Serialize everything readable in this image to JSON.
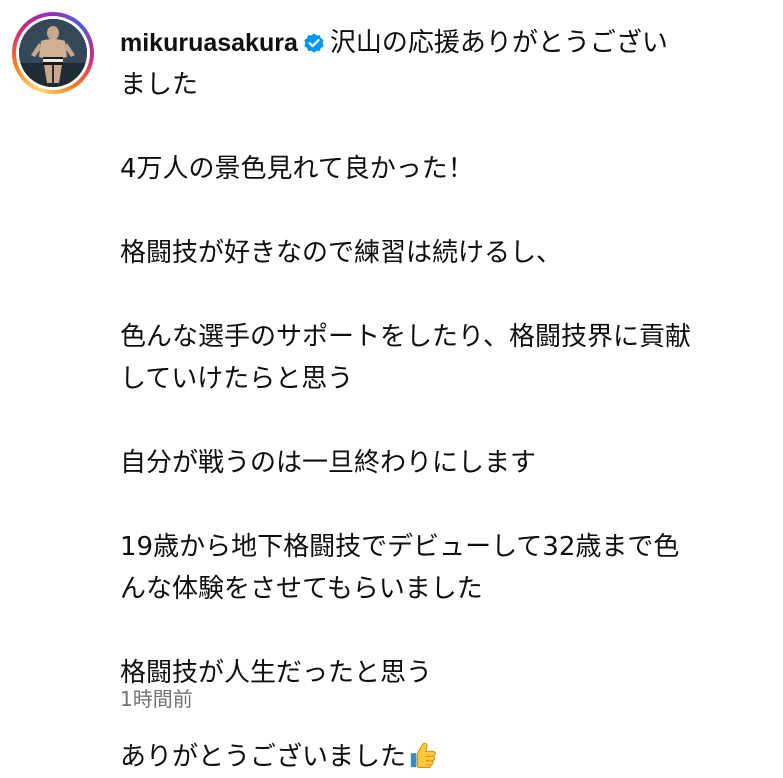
{
  "post": {
    "username": "mikuruasakura",
    "verified": true,
    "caption_lines": [
      "沢山の応援ありがとうござい",
      "ました",
      "",
      "4万人の景色見れて良かった！",
      "",
      "格闘技が好きなので練習は続けるし、",
      "",
      "色んな選手のサポートをしたり、格闘技界に貢献",
      "していけたらと思う",
      "",
      "自分が戦うのは一旦終わりにします",
      "",
      "19歳から地下格闘技でデビューして32歳まで色",
      "んな体験をさせてもらいました",
      "",
      "格闘技が人生だったと思う",
      "",
      "ありがとうございました"
    ],
    "trailing_emoji": "thumbs-up-icon",
    "timestamp": "1時間前"
  },
  "colors": {
    "text": "#0f0f0f",
    "muted": "#737373",
    "verified_blue": "#0095f6",
    "thumb_yellow": "#ffc83d"
  }
}
